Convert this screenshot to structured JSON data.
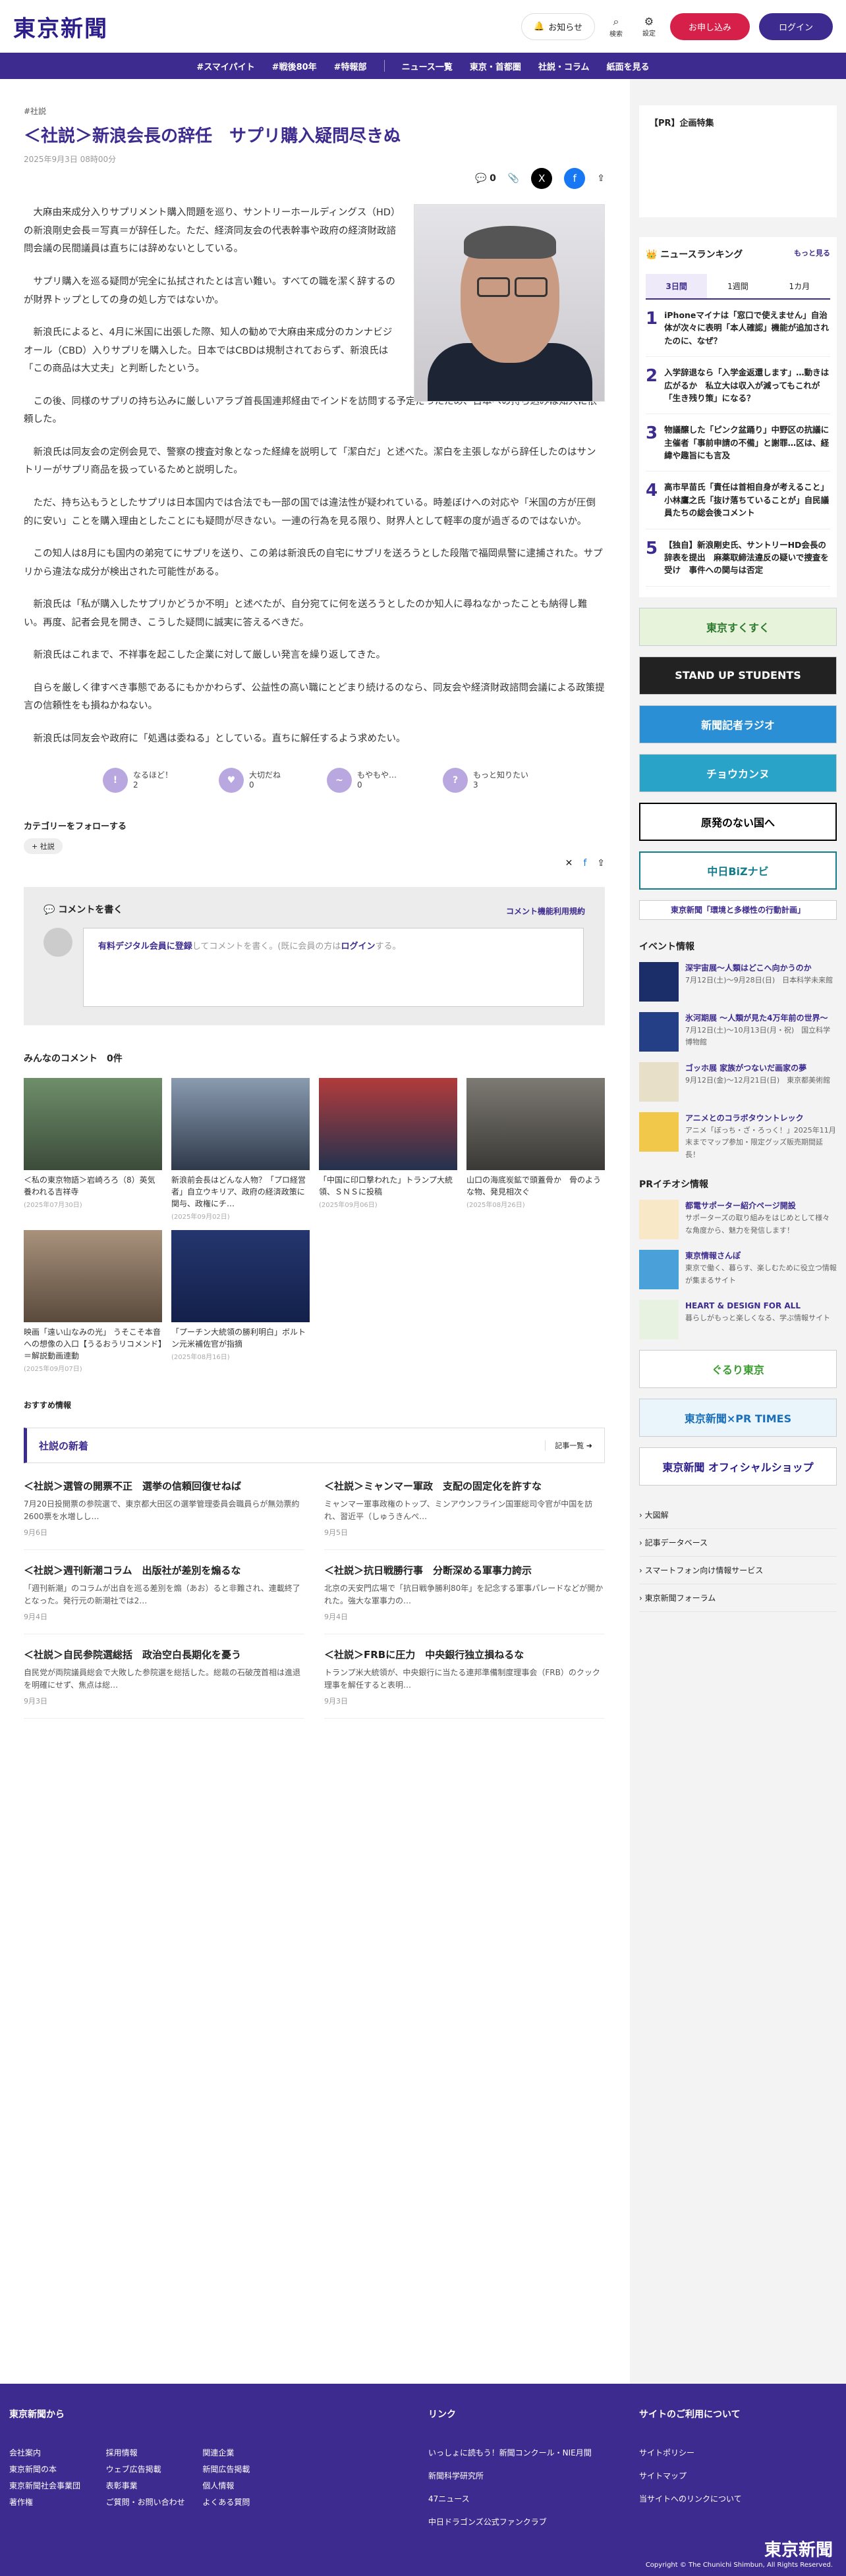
{
  "header": {
    "logo": "東京新聞",
    "notify": "お知らせ",
    "search": "検索",
    "settings": "設定",
    "apply": "お申し込み",
    "login": "ログイン"
  },
  "nav": [
    "#スマイパイト",
    "#戦後80年",
    "#特報部",
    "ニュース一覧",
    "東京・首都圏",
    "社説・コラム",
    "紙面を見る"
  ],
  "article": {
    "tag": "#社説",
    "title": "＜社説＞新浪会長の辞任　サプリ購入疑問尽きぬ",
    "date": "2025年9月3日 08時00分",
    "comment_count": "0",
    "paras": [
      "大麻由来成分入りサプリメント購入問題を巡り、サントリーホールディングス（HD）の新浪剛史会長＝写真＝が辞任した。ただ、経済同友会の代表幹事や政府の経済財政諮問会議の民間議員は直ちには辞めないとしている。",
      "サプリ購入を巡る疑問が完全に払拭されたとは言い難い。すべての職を潔く辞するのが財界トップとしての身の処し方ではないか。",
      "新浪氏によると、4月に米国に出張した際、知人の勧めで大麻由来成分のカンナビジオール（CBD）入りサプリを購入した。日本ではCBDは規制されておらず、新浪氏は「この商品は大丈夫」と判断したという。",
      "この後、同様のサプリの持ち込みに厳しいアラブ首長国連邦経由でインドを訪問する予定だったため、日本への持ち込みは知人に依頼した。",
      "新浪氏は同友会の定例会見で、警察の捜査対象となった経緯を説明して「潔白だ」と述べた。潔白を主張しながら辞任したのはサントリーがサプリ商品を扱っているためと説明した。",
      "ただ、持ち込もうとしたサプリは日本国内では合法でも一部の国では違法性が疑われている。時差ぼけへの対応や「米国の方が圧倒的に安い」ことを購入理由としたことにも疑問が尽きない。一連の行為を見る限り、財界人として軽率の度が過ぎるのではないか。",
      "この知人は8月にも国内の弟宛てにサプリを送り、この弟は新浪氏の自宅にサプリを送ろうとした段階で福岡県警に逮捕された。サプリから違法な成分が検出された可能性がある。",
      "新浪氏は「私が購入したサプリかどうか不明」と述べたが、自分宛てに何を送ろうとしたのか知人に尋ねなかったことも納得し難い。再度、記者会見を開き、こうした疑問に誠実に答えるべきだ。",
      "新浪氏はこれまで、不祥事を起こした企業に対して厳しい発言を繰り返してきた。",
      "自らを厳しく律すべき事態であるにもかかわらず、公益性の高い職にとどまり続けるのなら、同友会や経済財政諮問会議による政策提言の信頼性をも損ねかねない。",
      "新浪氏は同友会や政府に「処遇は委ねる」としている。直ちに解任するよう求めたい。"
    ]
  },
  "reactions": [
    {
      "label": "なるほど！",
      "count": "2"
    },
    {
      "label": "大切だね",
      "count": "0"
    },
    {
      "label": "もやもや…",
      "count": "0"
    },
    {
      "label": "もっと知りたい",
      "count": "3"
    }
  ],
  "follow": {
    "title": "カテゴリーをフォローする",
    "tag": "社説"
  },
  "comment": {
    "title": "コメントを書く",
    "rules": "コメント機能利用規約",
    "placeholder_link": "有料デジタル会員に登録",
    "placeholder_mid": "してコメントを書く。(既に会員の方は",
    "placeholder_login": "ログイン",
    "placeholder_end": "する。"
  },
  "all_comments": "みんなのコメント　0件",
  "cards": [
    {
      "cap": "＜私の東京物語＞岩崎ろろ（8）英気養われる吉祥寺",
      "d": "(2025年07月30日)"
    },
    {
      "cap": "新浪前会長はどんな人物？「プロ経営者」自立ウキリア、政府の経済政策に関与、政権にチ…",
      "d": "(2025年09月02日)"
    },
    {
      "cap": "「中国に印口撃われた」トランプ大統領、ＳＮＳに投稿",
      "d": "(2025年09月06日)"
    },
    {
      "cap": "山口の海底炭鉱で頭蓋骨か　骨のような物、発見相次ぐ",
      "d": "(2025年08月26日)"
    },
    {
      "cap": "映画「遠い山なみの光」 うそこそ本音への想像の入口【うるおうリコメンド】＝解説動画連動",
      "d": "(2025年09月07日)"
    },
    {
      "cap": "「プーチン大統領の勝利明白」ボルトン元米補佐官が指摘",
      "d": "(2025年08月16日)"
    }
  ],
  "reco": "おすすめ情報",
  "newest": {
    "title": "社説の新着",
    "more": "記事一覧"
  },
  "news": [
    {
      "h": "＜社説＞選管の開票不正　選挙の信頼回復せねば",
      "p": "7月20日投開票の参院選で、東京都大田区の選挙管理委員会職員らが無効票約2600票を水増しし…",
      "d": "9月6日"
    },
    {
      "h": "＜社説＞ミャンマー軍政　支配の固定化を許すな",
      "p": "ミャンマー軍事政権のトップ、ミンアウンフライン国軍総司令官が中国を訪れ、習近平（しゅうきんぺ…",
      "d": "9月5日"
    },
    {
      "h": "＜社説＞週刊新潮コラム　出版社が差別を煽るな",
      "p": "「週刊新潮」のコラムが出自を巡る差別を煽（あお）ると非難され、連載終了となった。発行元の新潮社では2…",
      "d": "9月4日"
    },
    {
      "h": "＜社説＞抗日戦勝行事　分断深める軍事力誇示",
      "p": "北京の天安門広場で「抗日戦争勝利80年」を記念する軍事パレードなどが開かれた。強大な軍事力の…",
      "d": "9月4日"
    },
    {
      "h": "＜社説＞自民参院選総括　政治空白長期化を憂う",
      "p": "自民党が両院議員総会で大敗した参院選を総括した。総裁の石破茂首相は進退を明確にせず、焦点は総…",
      "d": "9月3日"
    },
    {
      "h": "＜社説＞FRBに圧力　中央銀行独立損ねるな",
      "p": "トランプ米大統領が、中央銀行に当たる連邦準備制度理事会（FRB）のクック理事を解任すると表明…",
      "d": "9月3日"
    }
  ],
  "side": {
    "pr_title": "【PR】企画特集",
    "rank_title": "ニュースランキング",
    "rank_more": "もっと見る",
    "tabs": [
      "3日間",
      "1週間",
      "1カ月"
    ],
    "ranks": [
      "iPhoneマイナは「窓口で使えません」自治体が次々に表明「本人確認」機能が追加されたのに、なぜ？",
      "入学辞退なら「入学金返還します」…動きは広がるか　私立大は収入が減ってもこれが「生き残り策」になる？",
      "物議醸した「ピンク盆踊り」中野区の抗議に主催者「事前申請の不備」と謝罪…区は、経緯や趣旨にも言及",
      "高市早苗氏「責任は首相自身が考えること」小林鷹之氏「抜け落ちていることが」自民議員たちの総会後コメント",
      "【独自】新浪剛史氏、サントリーHD会長の辞表を提出　麻薬取締法違反の疑いで捜査を受け　事件への関与は否定"
    ],
    "banners": [
      "東京すくすく",
      "STAND UP STUDENTS",
      "新聞記者ラジオ",
      "チョウカンヌ",
      "原発のない国へ",
      "中日BiZナビ",
      "東京新聞「環境と多様性の行動計画」"
    ],
    "event_title": "イベント情報",
    "events": [
      {
        "t": "深宇宙展～人類はどこへ向かうのか",
        "s": "7月12日(土)～9月28日(日)　日本科学未来館"
      },
      {
        "t": "氷河期展 ～人類が見た4万年前の世界～",
        "s": "7月12日(土)～10月13日(月・祝)　国立科学博物館"
      },
      {
        "t": "ゴッホ展 家族がつないだ画家の夢",
        "s": "9月12日(金)～12月21日(日)　東京都美術館"
      },
      {
        "t": "アニメとのコラボタウントレック",
        "s": "アニメ「ぼっち・ざ・ろっく！」2025年11月末までマップ参加・限定グッズ販売期間延長！"
      }
    ],
    "pr_title2": "PRイチオシ情報",
    "prs": [
      {
        "t": "都電サポーター紹介ページ開設",
        "s": "サポーターズの取り組みをはじめとして様々な角度から、魅力を発信します！"
      },
      {
        "t": "東京情報さんぽ",
        "s": "東京で働く、暮らす、楽しむために役立つ情報が集まるサイト"
      },
      {
        "t": "HEART & DESIGN FOR ALL",
        "s": "暮らしがもっと楽しくなる、学ぶ情報サイト"
      }
    ],
    "banners2": [
      "ぐるり東京",
      "東京新聞×PR TIMES",
      "東京新聞 オフィシャルショップ"
    ],
    "links": [
      "大図解",
      "記事データベース",
      "スマートフォン向け情報サービス",
      "東京新聞フォーラム"
    ]
  },
  "footer": {
    "col1": "東京新聞から",
    "col1a": [
      "会社案内",
      "採用情報",
      "関連企業",
      "東京新聞の本",
      "ウェブ広告掲載",
      "新聞広告掲載",
      "東京新聞社会事業団",
      "表彰事業",
      "個人情報",
      "著作権",
      "ご質問・お問い合わせ",
      "よくある質問"
    ],
    "col2": "リンク",
    "col2a": [
      "いっしょに読もう！新聞コンクール・NIE月間",
      "新聞科学研究所",
      "47ニュース",
      "中日ドラゴンズ公式ファンクラブ"
    ],
    "col3": "サイトのご利用について",
    "col3a": [
      "サイトポリシー",
      "サイトマップ",
      "当サイトへのリンクについて"
    ],
    "logo": "東京新聞",
    "copy": "Copyright © The Chunichi Shimbun, All Rights Reserved."
  }
}
